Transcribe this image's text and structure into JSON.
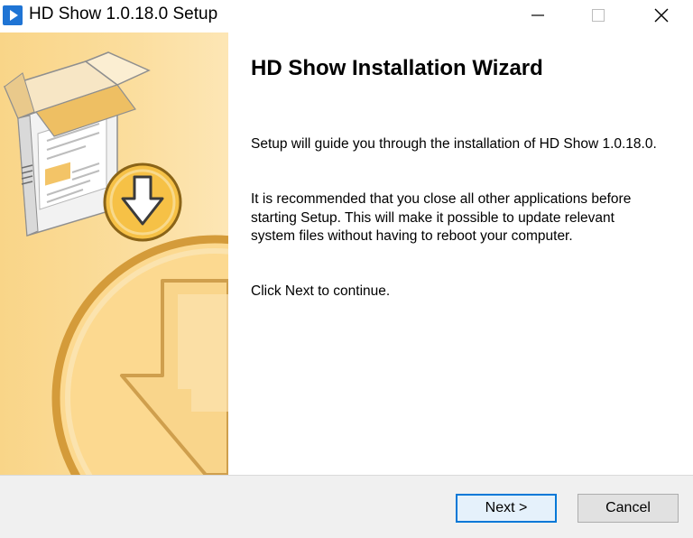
{
  "window": {
    "title": "HD Show 1.0.18.0 Setup",
    "icons": {
      "app": "app-play-icon",
      "minimize": "minimize-icon",
      "maximize": "maximize-icon",
      "close": "close-icon"
    }
  },
  "sidebar": {
    "image": "installer-box-download-illustration",
    "colors": {
      "background": "#fbdb98",
      "accent": "#f3b637"
    }
  },
  "main": {
    "heading": "HD Show Installation Wizard",
    "paragraphs": [
      "Setup will guide you through the installation of HD Show 1.0.18.0.",
      "It is recommended that you close all other applications before starting Setup. This will make it possible to update relevant system files without having to reboot your computer.",
      "Click Next to continue."
    ]
  },
  "buttons": {
    "next_label": "Next >",
    "cancel_label": "Cancel"
  },
  "colors": {
    "focus_border": "#0078d7",
    "button_bar": "#f0f0f0"
  }
}
